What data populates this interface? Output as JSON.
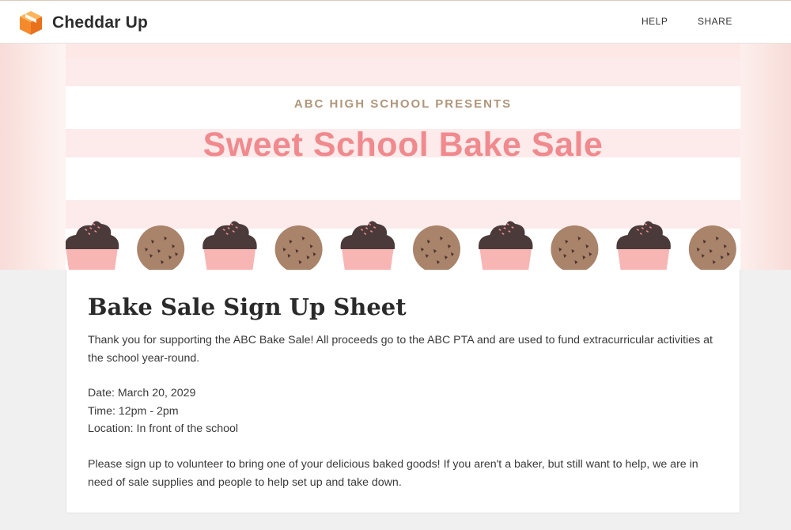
{
  "app": {
    "name": "Cheddar Up",
    "logo_icon": "cube-logo-icon",
    "brand_color": "#f58a2c"
  },
  "nav": {
    "help": "HELP",
    "share": "SHARE"
  },
  "banner": {
    "subtitle": "ABC HIGH SCHOOL PRESENTS",
    "title": "Sweet School Bake Sale",
    "title_color": "#f08a8e",
    "subtitle_color": "#b0967a",
    "decorations": [
      "cupcake-icon",
      "cookie-icon",
      "cupcake-icon",
      "cookie-icon",
      "cupcake-icon",
      "cookie-icon",
      "cupcake-icon",
      "cookie-icon",
      "cupcake-icon",
      "cookie-icon"
    ]
  },
  "content": {
    "title": "Bake Sale Sign Up Sheet",
    "intro": "Thank you for supporting the ABC Bake Sale! All proceeds go to the ABC PTA and are used to fund extracurricular activities at the school year-round.",
    "date": "Date: March 20, 2029",
    "time": "Time: 12pm - 2pm",
    "location": "Location: In front of the school",
    "call_to_action": "Please sign up to volunteer to bring one of your delicious baked goods! If you aren't a baker, but still want to help, we are in need of sale supplies and people to help set up and take down."
  }
}
